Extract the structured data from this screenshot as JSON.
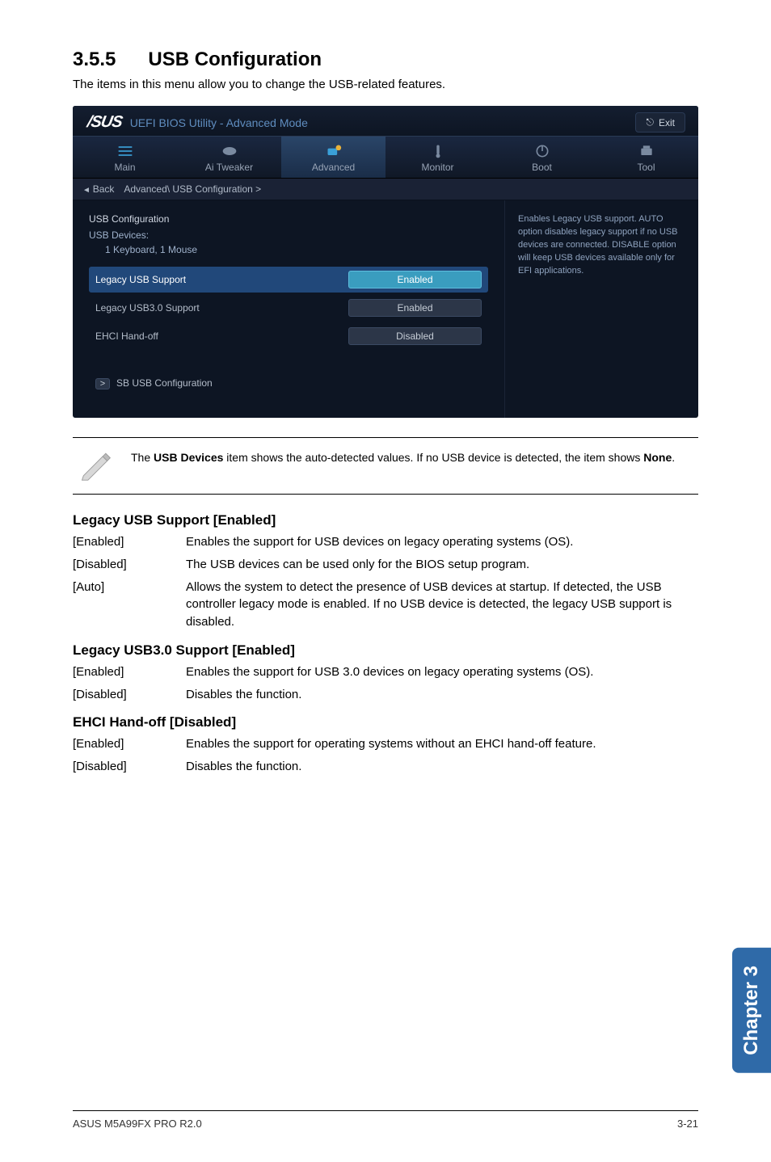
{
  "section": {
    "number": "3.5.5",
    "title": "USB Configuration"
  },
  "intro": "The items in this menu allow you to change the USB-related features.",
  "bios": {
    "brand": "/SUS",
    "headerTitle": "UEFI BIOS Utility - Advanced Mode",
    "exit": "Exit",
    "tabs": [
      "Main",
      "Ai Tweaker",
      "Advanced",
      "Monitor",
      "Boot",
      "Tool"
    ],
    "activeTabIndex": 2,
    "breadcrumb": {
      "back": "Back",
      "path": "Advanced\\ USB Configuration >"
    },
    "configTitle": "USB Configuration",
    "devicesLabel": "USB Devices:",
    "devicesValue": "1 Keyboard, 1 Mouse",
    "rows": [
      {
        "label": "Legacy USB Support",
        "value": "Enabled",
        "highlight": true
      },
      {
        "label": "Legacy USB3.0 Support",
        "value": "Enabled",
        "highlight": false
      },
      {
        "label": "EHCI Hand-off",
        "value": "Disabled",
        "highlight": false
      }
    ],
    "sbRow": "SB USB Configuration",
    "help": "Enables Legacy USB support. AUTO option disables legacy support if no USB devices are connected. DISABLE option will keep USB devices available only for EFI applications."
  },
  "note": {
    "prefix": "The ",
    "bold1": "USB Devices",
    "mid": " item shows the auto-detected values. If no USB device is detected, the item shows ",
    "bold2": "None",
    "suffix": "."
  },
  "settings": [
    {
      "heading": "Legacy USB Support [Enabled]",
      "options": [
        {
          "key": "[Enabled]",
          "val": "Enables the support for USB devices on legacy operating systems (OS)."
        },
        {
          "key": "[Disabled]",
          "val": "The USB devices can be used only for the BIOS setup program."
        },
        {
          "key": "[Auto]",
          "val": "Allows the system to detect the presence of USB devices at startup. If detected, the USB controller legacy mode is enabled. If no USB device is detected, the legacy USB support is disabled."
        }
      ]
    },
    {
      "heading": "Legacy USB3.0 Support [Enabled]",
      "options": [
        {
          "key": "[Enabled]",
          "val": "Enables the support for USB 3.0 devices on legacy operating systems (OS)."
        },
        {
          "key": "[Disabled]",
          "val": "Disables the function."
        }
      ]
    },
    {
      "heading": "EHCI Hand-off [Disabled]",
      "options": [
        {
          "key": "[Enabled]",
          "val": "Enables the support for operating systems without an EHCI hand-off feature."
        },
        {
          "key": "[Disabled]",
          "val": "Disables the function."
        }
      ]
    }
  ],
  "chapterTab": "Chapter 3",
  "footer": {
    "left": "ASUS M5A99FX PRO R2.0",
    "right": "3-21"
  },
  "icons": {
    "exit": "⎋",
    "main": "☰",
    "tweaker": "⬤",
    "advanced": "🛠",
    "monitor": "🌡",
    "boot": "⏻",
    "tool": "🖨",
    "sbArrow": ">"
  },
  "colors": {
    "accentTeal": "#3a9dbf",
    "highlightBlue": "#21487a"
  }
}
